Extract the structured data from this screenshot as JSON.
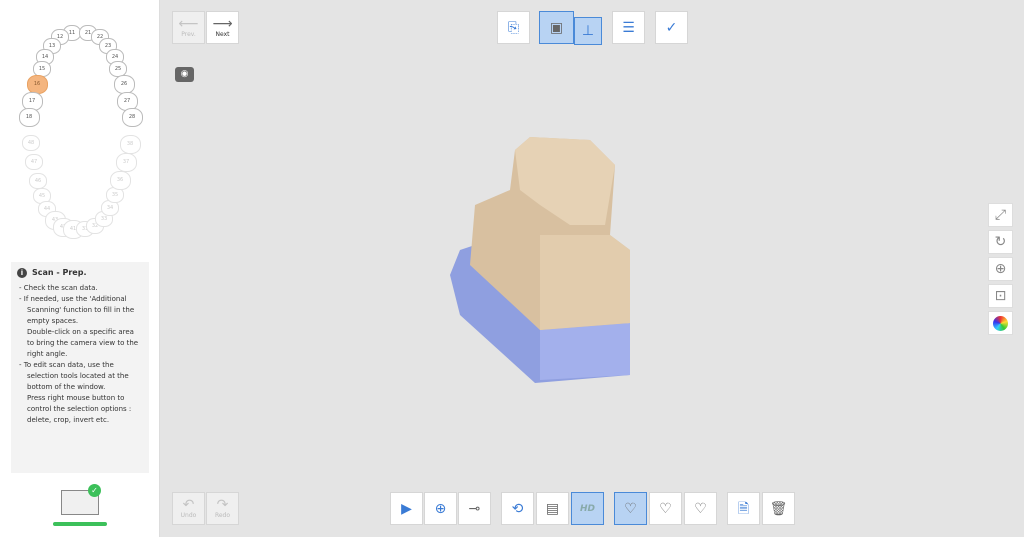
{
  "teeth": {
    "upper": [
      {
        "n": "11"
      },
      {
        "n": "12"
      },
      {
        "n": "13"
      },
      {
        "n": "14"
      },
      {
        "n": "15"
      },
      {
        "n": "16",
        "selected": true
      },
      {
        "n": "17"
      },
      {
        "n": "18"
      },
      {
        "n": "21"
      },
      {
        "n": "22"
      },
      {
        "n": "23"
      },
      {
        "n": "24"
      },
      {
        "n": "25"
      },
      {
        "n": "26"
      },
      {
        "n": "27"
      },
      {
        "n": "28"
      }
    ],
    "lower": [
      {
        "n": "48"
      },
      {
        "n": "47"
      },
      {
        "n": "46"
      },
      {
        "n": "45"
      },
      {
        "n": "44"
      },
      {
        "n": "43"
      },
      {
        "n": "42"
      },
      {
        "n": "41"
      },
      {
        "n": "31"
      },
      {
        "n": "32"
      },
      {
        "n": "33"
      },
      {
        "n": "34"
      },
      {
        "n": "35"
      },
      {
        "n": "36"
      },
      {
        "n": "37"
      },
      {
        "n": "38"
      }
    ],
    "selected_color": "#f4b57f"
  },
  "info": {
    "title": "Scan - Prep.",
    "items": [
      {
        "line": "Check the scan data."
      },
      {
        "line": "If needed, use the 'Additional Scanning' function to fill in the empty spaces.",
        "extra": "Double-click on a specific area to bring the camera view to the right angle."
      },
      {
        "line": "To edit scan data, use the selection tools located at the bottom of the window.",
        "extra": "Press right mouse button to control the selection options : delete, crop, invert etc."
      }
    ]
  },
  "nav": {
    "prev": "Prev.",
    "next": "Next",
    "undo": "Undo",
    "redo": "Redo"
  },
  "bottom_toolbar": {
    "hd_label": "HD"
  },
  "colors": {
    "accent": "#3a7bd5",
    "active_bg": "#b8d3f3",
    "success": "#3cc05a",
    "model_stone": "#d8c0a0",
    "model_base": "#8f9fe0"
  }
}
